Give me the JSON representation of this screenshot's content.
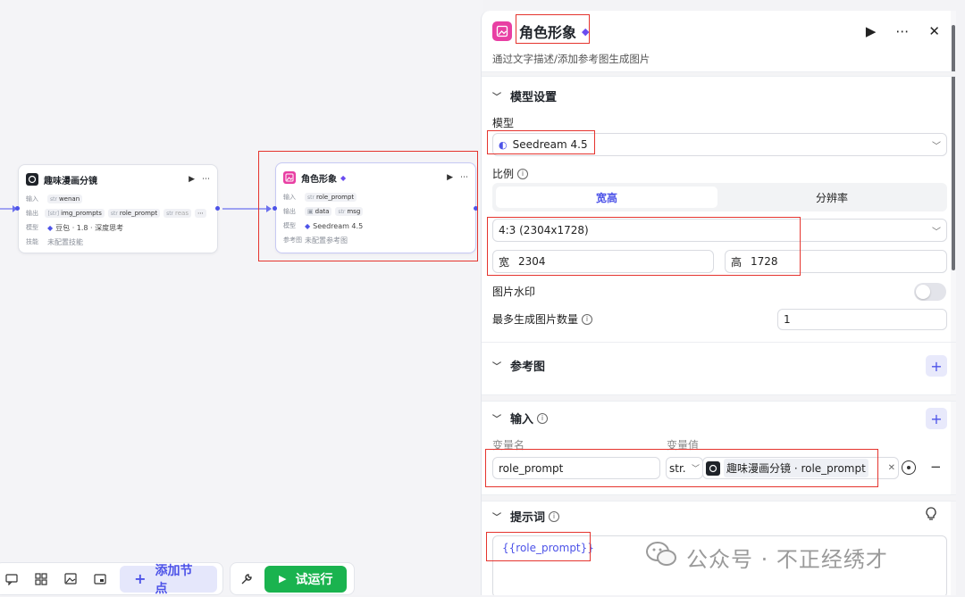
{
  "canvas": {
    "node1": {
      "title": "趣味漫画分镜",
      "input_label": "输入",
      "input_type": "str",
      "input_value": "wenan",
      "output_label": "输出",
      "outputs": [
        {
          "type": "[str]",
          "name": "img_prompts"
        },
        {
          "type": "str",
          "name": "role_prompt"
        },
        {
          "type": "str",
          "name": "reas"
        }
      ],
      "model_label": "模型",
      "model_value": "豆包 · 1.8 · 深度思考",
      "skill_label": "技能",
      "skill_value": "未配置技能"
    },
    "node2": {
      "title": "角色形象",
      "input_label": "输入",
      "input_type": "str",
      "input_value": "role_prompt",
      "output_label": "输出",
      "outputs": [
        {
          "type": "",
          "name": "data"
        },
        {
          "type": "str",
          "name": "msg"
        }
      ],
      "model_label": "模型",
      "model_value": "Seedream 4.5",
      "ref_label": "参考图",
      "ref_value": "未配置参考图"
    }
  },
  "toolbar": {
    "add_node": "添加节点",
    "run": "试运行"
  },
  "panel": {
    "title": "角色形象",
    "description": "通过文字描述/添加参考图生成图片",
    "model_settings": "模型设置",
    "model_label": "模型",
    "model_value": "Seedream 4.5",
    "ratio_label": "比例",
    "tab_active": "宽高",
    "tab_inactive": "分辨率",
    "ratio_value": "4:3 (2304x1728)",
    "width_label": "宽",
    "width_value": "2304",
    "height_label": "高",
    "height_value": "1728",
    "watermark_label": "图片水印",
    "max_count_label": "最多生成图片数量",
    "max_count_value": "1",
    "ref_section": "参考图",
    "input_section": "输入",
    "var_name_header": "变量名",
    "var_value_header": "变量值",
    "var_name": "role_prompt",
    "var_type": "str.",
    "var_ref": "趣味漫画分镜 · role_prompt",
    "prompt_section": "提示词",
    "prompt_value": "{{role_prompt}}"
  },
  "watermark": "公众号 · 不正经绣才",
  "colors": {
    "accent": "#4d53e8",
    "run_green": "#1ab34f",
    "highlight_red": "#e5342e",
    "image_node_pink": "#e83fa3"
  }
}
